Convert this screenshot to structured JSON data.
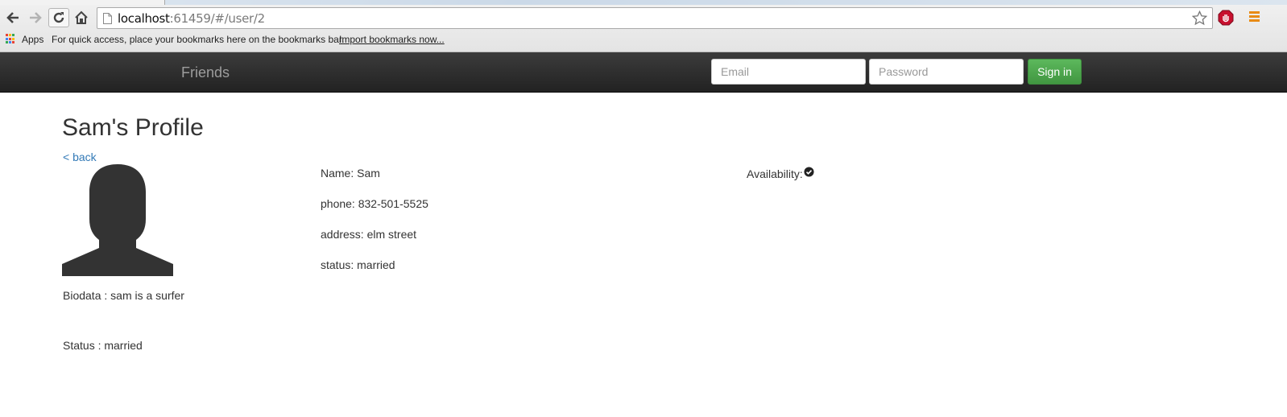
{
  "browser": {
    "url_host": "localhost",
    "url_rest": ":61459/#/user/2",
    "bookmarks": {
      "apps_label": "Apps",
      "hint": "For quick access, place your bookmarks here on the bookmarks bar.",
      "import_link": "Import bookmarks now..."
    }
  },
  "navbar": {
    "brand": "Friends",
    "email_placeholder": "Email",
    "password_placeholder": "Password",
    "signin_label": "Sign in",
    "signin_color": "#5cb85c"
  },
  "profile": {
    "title": "Sam's Profile",
    "back_link": "< back",
    "biodata": "Biodata : sam is a surfer",
    "status_summary": "Status : married",
    "details": {
      "name": "Name: Sam",
      "phone": "phone: 832-501-5525",
      "address": "address: elm street",
      "status": "status: married"
    },
    "availability_label": "Availability:",
    "availability_icon": "check-circle-icon"
  },
  "colors": {
    "link": "#337ab7",
    "navbar_bg": "#222222",
    "apps_grid": [
      "#e94235",
      "#fbbc05",
      "#34a853",
      "#4285f4",
      "#e94235",
      "#fbbc05",
      "#34a853",
      "#4285f4",
      "#e94235"
    ]
  }
}
